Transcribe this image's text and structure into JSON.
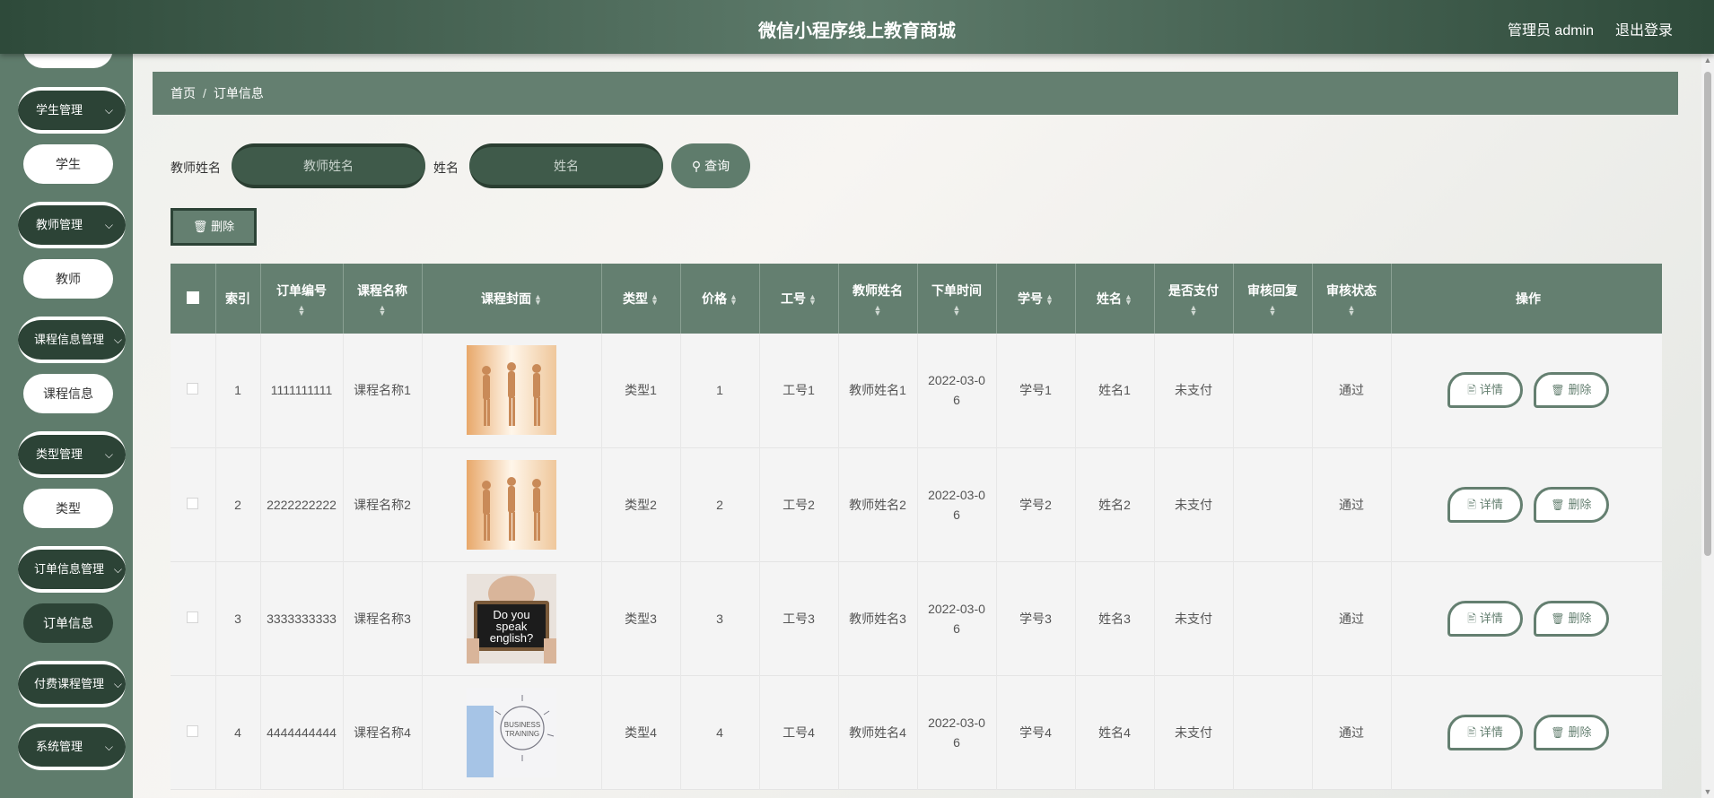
{
  "header": {
    "title": "微信小程序线上教育商城",
    "user": "管理员 admin",
    "logout": "退出登录"
  },
  "sidebar": {
    "groups": [
      {
        "label": "学生管理",
        "sub": "学生"
      },
      {
        "label": "教师管理",
        "sub": "教师"
      },
      {
        "label": "课程信息管理",
        "sub": "课程信息"
      },
      {
        "label": "类型管理",
        "sub": "类型"
      },
      {
        "label": "订单信息管理",
        "sub": "订单信息"
      },
      {
        "label": "付费课程管理",
        "sub": ""
      },
      {
        "label": "系统管理",
        "sub": ""
      }
    ]
  },
  "breadcrumb": {
    "home": "首页",
    "sep": "/",
    "current": "订单信息"
  },
  "search": {
    "teacher_label": "教师姓名",
    "teacher_placeholder": "教师姓名",
    "name_label": "姓名",
    "name_placeholder": "姓名",
    "query": "查询"
  },
  "actions": {
    "bulk_delete": "删除"
  },
  "table": {
    "columns": [
      "索引",
      "订单编号",
      "课程名称",
      "课程封面",
      "类型",
      "价格",
      "工号",
      "教师姓名",
      "下单时间",
      "学号",
      "姓名",
      "是否支付",
      "审核回复",
      "审核状态",
      "操作"
    ],
    "rows": [
      {
        "index": "1",
        "order_no": "1111111111",
        "course": "课程名称1",
        "cover": "dance-photo",
        "type": "类型1",
        "price": "1",
        "staff_no": "工号1",
        "teacher": "教师姓名1",
        "time": "2022-03-06",
        "student_no": "学号1",
        "name": "姓名1",
        "paid": "未支付",
        "reply": "",
        "status": "通过"
      },
      {
        "index": "2",
        "order_no": "2222222222",
        "course": "课程名称2",
        "cover": "dance-photo",
        "type": "类型2",
        "price": "2",
        "staff_no": "工号2",
        "teacher": "教师姓名2",
        "time": "2022-03-06",
        "student_no": "学号2",
        "name": "姓名2",
        "paid": "未支付",
        "reply": "",
        "status": "通过"
      },
      {
        "index": "3",
        "order_no": "3333333333",
        "course": "课程名称3",
        "cover": "english-sign-photo",
        "type": "类型3",
        "price": "3",
        "staff_no": "工号3",
        "teacher": "教师姓名3",
        "time": "2022-03-06",
        "student_no": "学号3",
        "name": "姓名3",
        "paid": "未支付",
        "reply": "",
        "status": "通过"
      },
      {
        "index": "4",
        "order_no": "4444444444",
        "course": "课程名称4",
        "cover": "business-training-photo",
        "type": "类型4",
        "price": "4",
        "staff_no": "工号4",
        "teacher": "教师姓名4",
        "time": "2022-03-06",
        "student_no": "学号4",
        "name": "姓名4",
        "paid": "未支付",
        "reply": "",
        "status": "通过"
      }
    ],
    "row_actions": {
      "detail": "详情",
      "delete": "删除"
    }
  },
  "photo_text": {
    "english": [
      "Do you",
      "speak",
      "english?"
    ],
    "business": [
      "BUSINESS",
      "TRAINING"
    ]
  },
  "colors": {
    "primary": "#647f70",
    "dark": "#2c4336",
    "header": "#2e4a3a"
  }
}
